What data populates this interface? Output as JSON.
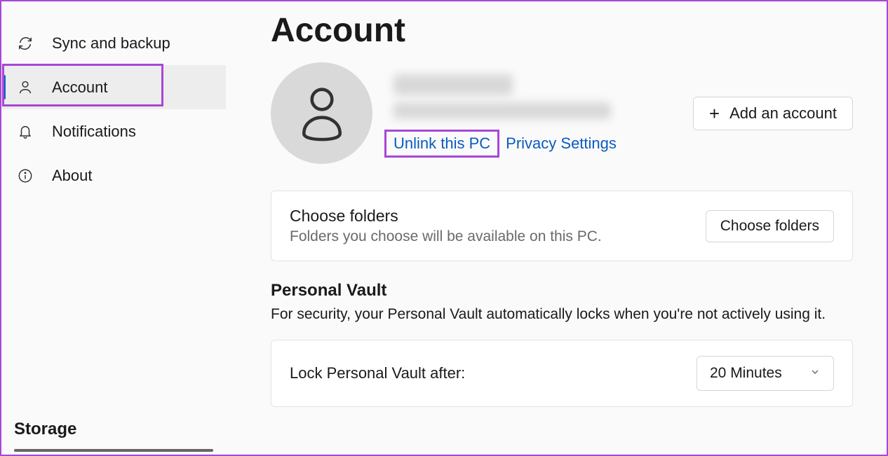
{
  "sidebar": {
    "items": [
      {
        "label": "Sync and backup"
      },
      {
        "label": "Account"
      },
      {
        "label": "Notifications"
      },
      {
        "label": "About"
      }
    ],
    "storage_heading": "Storage"
  },
  "main": {
    "title": "Account",
    "links": {
      "unlink": "Unlink this PC",
      "privacy": "Privacy Settings"
    },
    "add_account_label": "Add an account",
    "choose_folders": {
      "title": "Choose folders",
      "subtitle": "Folders you choose will be available on this PC.",
      "button": "Choose folders"
    },
    "personal_vault": {
      "title": "Personal Vault",
      "desc": "For security, your Personal Vault automatically locks when you're not actively using it.",
      "lock_label": "Lock Personal Vault after:",
      "lock_value": "20 Minutes"
    }
  }
}
